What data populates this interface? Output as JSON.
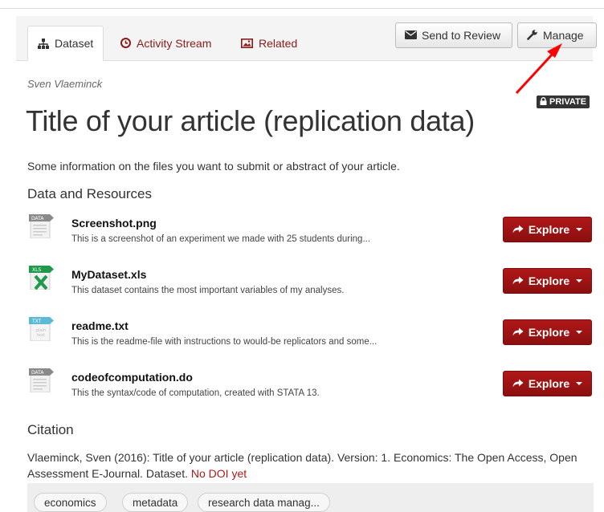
{
  "tabs": [
    {
      "label": "Dataset",
      "icon": "sitemap-icon",
      "active": true
    },
    {
      "label": "Activity Stream",
      "icon": "clock-icon",
      "active": false
    },
    {
      "label": "Related",
      "icon": "picture-icon",
      "active": false
    }
  ],
  "actions": {
    "send_review": {
      "label": "Send to Review",
      "icon": "envelope-icon"
    },
    "manage": {
      "label": "Manage",
      "icon": "wrench-icon"
    }
  },
  "dataset": {
    "author": "Sven Vlaeminck",
    "private_badge": "PRIVATE",
    "title": "Title of your article (replication data)",
    "description": "Some information on the files you want to submit or abstract of your article."
  },
  "resources_heading": "Data and Resources",
  "resources": [
    {
      "name": "Screenshot.png",
      "desc": "This is a screenshot of an experiment we made with 25 students during...",
      "format": "DATA",
      "explore": "Explore"
    },
    {
      "name": "MyDataset.xls",
      "desc": "This dataset contains the most important variables of my analyses.",
      "format": "XLS",
      "explore": "Explore"
    },
    {
      "name": "readme.txt",
      "desc": "This is the readme-file with instructions to would-be replicators and some...",
      "format": "TXT",
      "explore": "Explore"
    },
    {
      "name": "codeofcomputation.do",
      "desc": "This the syntax/code of computation, created with STATA 13.",
      "format": "DATA",
      "explore": "Explore"
    }
  ],
  "citation": {
    "heading": "Citation",
    "text": "Vlaeminck, Sven (2016): Title of your article (replication data). Version: 1. Economics: The Open Access, Open Assessment E-Journal. Dataset.",
    "no_doi": "No DOI yet"
  },
  "tags": [
    "economics",
    "metadata",
    "research data manag..."
  ],
  "colors": {
    "accent": "#8b1a1a",
    "explore": "#a01515",
    "annotation_arrow": "#ff0000"
  }
}
